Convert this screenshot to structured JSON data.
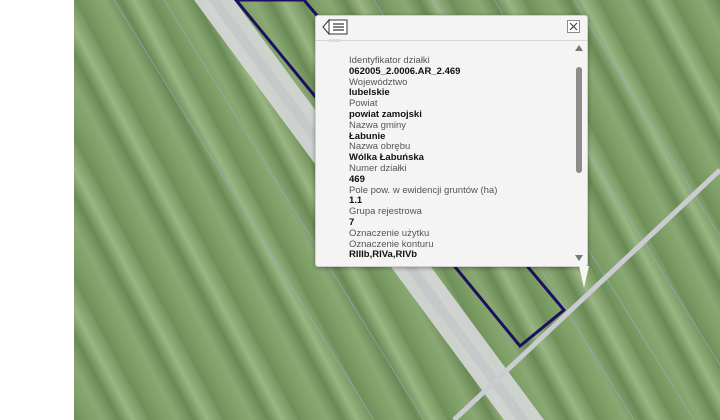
{
  "popup": {
    "list_icon": "list-icon",
    "close_icon": "close-icon",
    "fields": [
      {
        "label": "Identyfikator działki",
        "value": "062005_2.0006.AR_2.469"
      },
      {
        "label": "Województwo",
        "value": "lubelskie"
      },
      {
        "label": "Powiat",
        "value": "powiat zamojski"
      },
      {
        "label": "Nazwa gminy",
        "value": "Łabunie"
      },
      {
        "label": "Nazwa obrębu",
        "value": "Wólka Łabuńska"
      },
      {
        "label": "Numer działki",
        "value": "469"
      },
      {
        "label": "Pole pow. w ewidencji gruntów (ha)",
        "value": "1.1"
      },
      {
        "label": "Grupa rejestrowa",
        "value": "7"
      },
      {
        "label": "Oznaczenie użytku",
        "value": ""
      },
      {
        "label": "Oznaczenie konturu",
        "value": "RIIIb,RIVa,RIVb"
      }
    ]
  },
  "colors": {
    "parcel_outline": "#1c1060",
    "road": "#d9dadb",
    "field_green": "#7d9b66",
    "parcel_line": "#8a9ab8"
  }
}
